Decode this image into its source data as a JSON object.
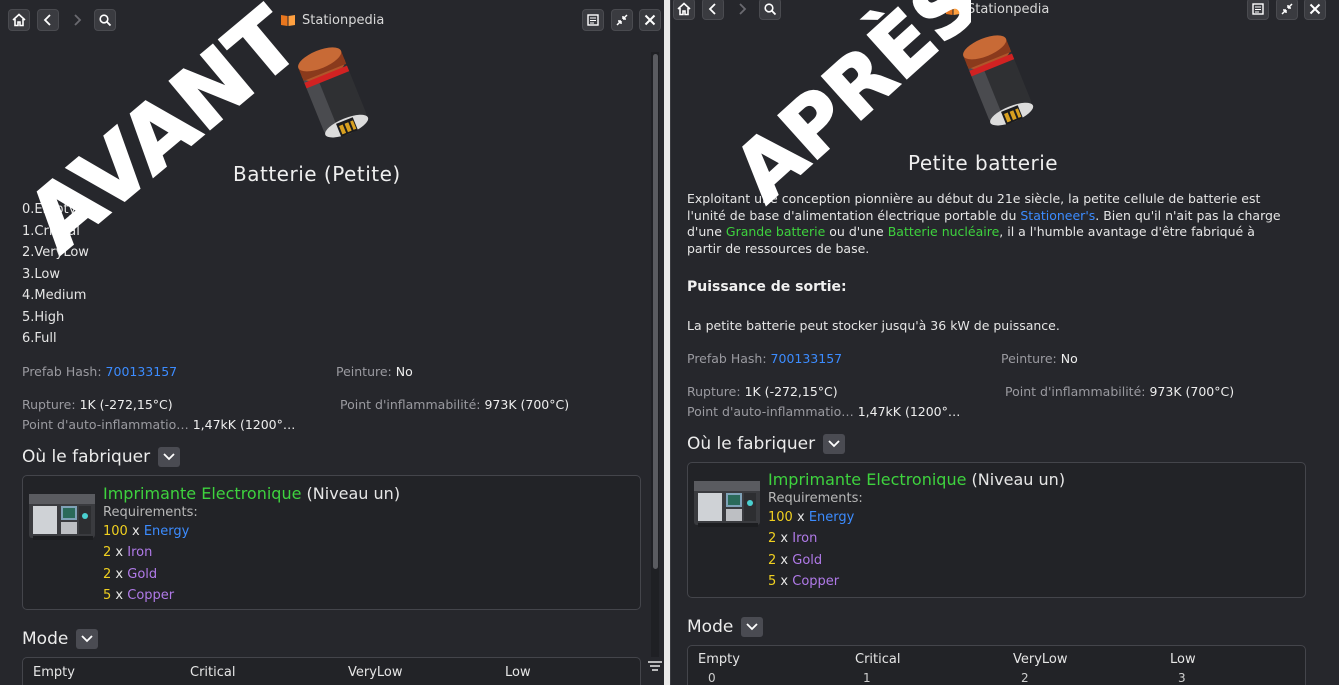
{
  "window_title": "Stationpedia",
  "before": {
    "overlay_word": "AVANT",
    "title": "Batterie (Petite)",
    "states": [
      "0.Empty",
      "1.Critical",
      "2.VeryLow",
      "3.Low",
      "4.Medium",
      "5.High",
      "6.Full"
    ],
    "props": {
      "prefab_hash_label": "Prefab Hash:",
      "prefab_hash_value": "700133157",
      "paint_label": "Peinture:",
      "paint_value": "No",
      "break_label": "Rupture:",
      "break_value": "1K (-272,15°C)",
      "flash_label": "Point d'inflammabilité:",
      "flash_value": "973K (700°C)",
      "autoign_label": "Point d'auto-inflammatio…",
      "autoign_value": "1,47kK (1200°…"
    },
    "where_to_make": "Où le fabriquer",
    "fabricator": {
      "name": "Imprimante Electronique",
      "tier": "(Niveau un)",
      "requirements_label": "Requirements:"
    },
    "requirements": [
      {
        "qty": "100",
        "x": "x",
        "name": "Energy"
      },
      {
        "qty": "2",
        "x": "x",
        "name": "Iron"
      },
      {
        "qty": "2",
        "x": "x",
        "name": "Gold"
      },
      {
        "qty": "5",
        "x": "x",
        "name": "Copper"
      }
    ],
    "mode_label": "Mode",
    "mode_headers": [
      "Empty",
      "Critical",
      "VeryLow",
      "Low"
    ]
  },
  "after": {
    "overlay_word": "APRÈS",
    "title": "Petite batterie",
    "description": {
      "p1": "Exploitant une conception pionnière au début du 21e siècle, la petite cellule de batterie est l'unité de base d'alimentation électrique portable du ",
      "link1": "Stationeer's",
      "p2": ". Bien qu'il n'ait pas la charge d'une ",
      "link2": "Grande batterie",
      "p3": " ou d'une ",
      "link3": "Batterie nucléaire",
      "p4": ", il a l'humble avantage d'être fabriqué à partir de ressources de base."
    },
    "output_heading": "Puissance de sortie:",
    "output_text": "La petite batterie peut stocker jusqu'à 36 kW de puissance.",
    "props": {
      "prefab_hash_label": "Prefab Hash:",
      "prefab_hash_value": "700133157",
      "paint_label": "Peinture:",
      "paint_value": "No",
      "break_label": "Rupture:",
      "break_value": "1K (-272,15°C)",
      "flash_label": "Point d'inflammabilité:",
      "flash_value": "973K (700°C)",
      "autoign_label": "Point d'auto-inflammatio…",
      "autoign_value": "1,47kK (1200°…"
    },
    "where_to_make": "Où le fabriquer",
    "fabricator": {
      "name": "Imprimante Electronique",
      "tier": "(Niveau un)",
      "requirements_label": "Requirements:"
    },
    "requirements": [
      {
        "qty": "100",
        "x": "x",
        "name": "Energy"
      },
      {
        "qty": "2",
        "x": "x",
        "name": "Iron"
      },
      {
        "qty": "2",
        "x": "x",
        "name": "Gold"
      },
      {
        "qty": "5",
        "x": "x",
        "name": "Copper"
      }
    ],
    "mode_label": "Mode",
    "mode_headers": [
      "Empty",
      "Critical",
      "VeryLow",
      "Low"
    ],
    "mode_values": [
      "0",
      "1",
      "2",
      "3"
    ]
  },
  "icons": [
    "home-icon",
    "back-icon",
    "forward-icon",
    "search-icon",
    "book-icon",
    "wiki-icon",
    "collapse-icon",
    "close-icon",
    "chevron-down-icon",
    "filter-icon"
  ],
  "colors": {
    "background": "#26272c",
    "link_blue": "#3c8cff",
    "link_green": "#3ed23e",
    "quantity_yellow": "#f0d020",
    "resource_purple": "#b07ae8"
  }
}
